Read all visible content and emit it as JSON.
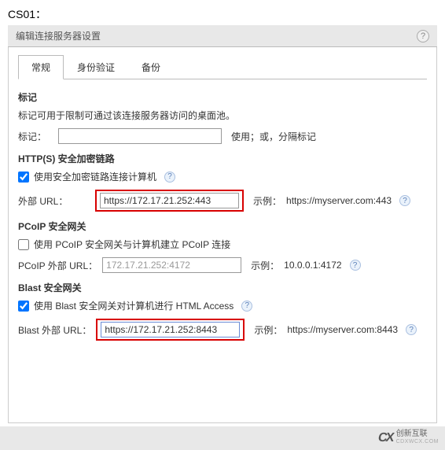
{
  "server_label": "CS01：",
  "dialog": {
    "title": "编辑连接服务器设置"
  },
  "tabs": {
    "general": "常规",
    "auth": "身份验证",
    "backup": "备份"
  },
  "tags": {
    "section_title": "标记",
    "desc": "标记可用于限制可通过该连接服务器访问的桌面池。",
    "label": "标记：",
    "value": "",
    "hint": "使用；或，分隔标记"
  },
  "https": {
    "section_title": "HTTP(S) 安全加密链路",
    "cb_label": "使用安全加密链路连接计算机",
    "cb_checked": true,
    "url_label": "外部 URL：",
    "url_value": "https://172.17.21.252:443",
    "hint_prefix": "示例：",
    "hint_url": "https://myserver.com:443"
  },
  "pcoip": {
    "section_title": "PCoIP 安全网关",
    "cb_label": "使用 PCoIP 安全网关与计算机建立 PCoIP 连接",
    "cb_checked": false,
    "url_label": "PCoIP 外部 URL：",
    "url_value": "172.17.21.252:4172",
    "hint_prefix": "示例：",
    "hint_url": "10.0.0.1:4172"
  },
  "blast": {
    "section_title": "Blast 安全网关",
    "cb_label": "使用 Blast 安全网关对计算机进行 HTML Access",
    "cb_checked": true,
    "url_label": "Blast 外部 URL：",
    "url_value": "https://172.17.21.252:8443",
    "hint_prefix": "示例：",
    "hint_url": "https://myserver.com:8443"
  },
  "logo": {
    "company": "创新互联",
    "sub": "CDXWCX.COM"
  }
}
